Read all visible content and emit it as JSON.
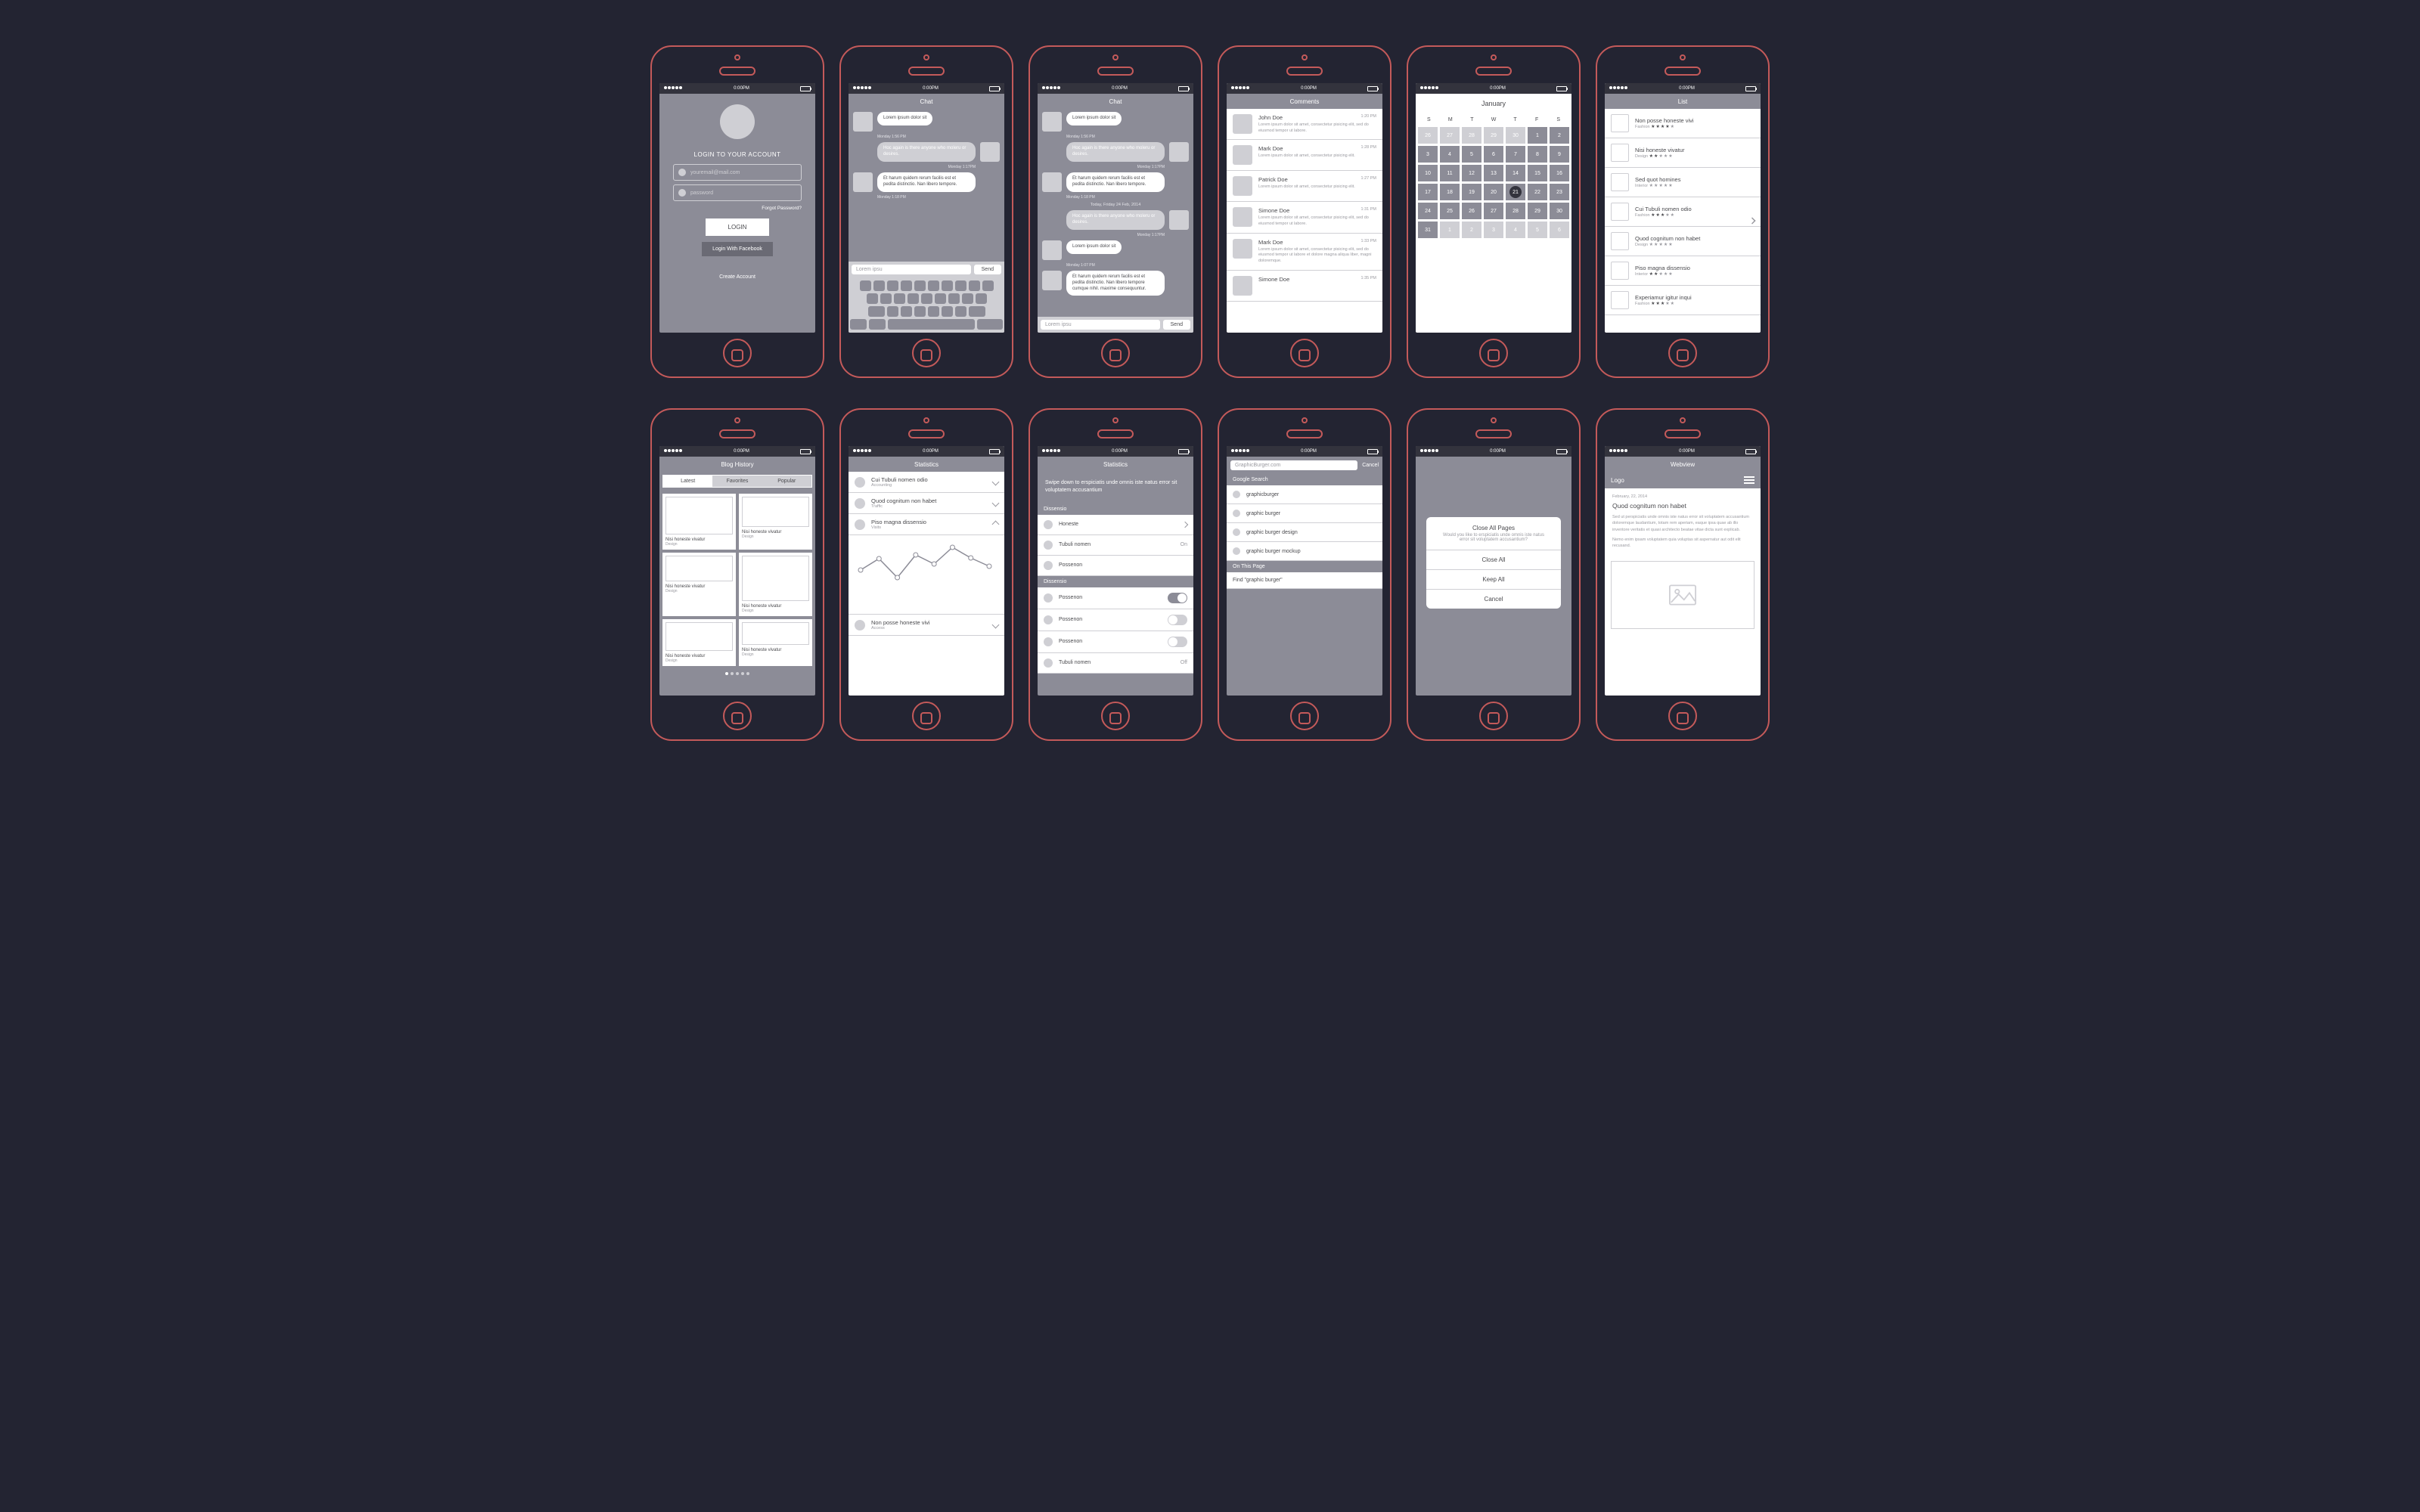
{
  "statusbar": {
    "time": "0:00PM"
  },
  "login": {
    "title": "LOGIN TO YOUR ACCOUNT",
    "email_ph": "youremail@mail.com",
    "pwd_ph": "password",
    "forgot": "Forgot Password?",
    "login_btn": "LOGIN",
    "fb_btn": "Login With Facebook",
    "create": "Create Account"
  },
  "chat": {
    "title": "Chat",
    "send": "Send",
    "input_ph": "Lorem ipsu",
    "date_divider": "Today, Friday 24 Feb, 2014",
    "msgs": [
      {
        "side": "l",
        "text": "Lorem ipsum dolor sit",
        "ts": "Monday 1:56 PM"
      },
      {
        "side": "r",
        "text": "Hoc again is there anyone who moleru or desires.",
        "ts": "Monday 1:17PM"
      },
      {
        "side": "l",
        "text": "Et harum quidem rerum facilis est et pedita distinctio. Nan libero tempore.",
        "ts": "Monday 1:18 PM"
      }
    ],
    "more": [
      {
        "side": "r",
        "text": "Hoc again is there anyone who moleru or desires.",
        "ts": "Monday 1:17PM"
      },
      {
        "side": "l",
        "text": "Lorem ipsum dolor sit",
        "ts": "Monday 1:07 PM"
      },
      {
        "side": "l",
        "text": "Et harum quidem rerum facilis est et pedita distinctio. Nan libero tempore cumque nihil. maxime consequuntur.",
        "ts": ""
      }
    ]
  },
  "comments": {
    "title": "Comments",
    "items": [
      {
        "name": "John Doe",
        "time": "1:20 PM",
        "text": "Lorem ipsum dolor sit amet, consectetur pisicing elit, sed do eiusmod tempor ut labore."
      },
      {
        "name": "Mark Doe",
        "time": "1:28 PM",
        "text": "Lorem ipsum dolor sit amet, consectetur pisicing elit."
      },
      {
        "name": "Patrick Doe",
        "time": "1:27 PM",
        "text": "Lorem ipsum dolor sit amet, consectetur pisicing elit."
      },
      {
        "name": "Simone Doe",
        "time": "1:31 PM",
        "text": "Lorem ipsum dolor sit amet, consectetur pisicing elit, sed do eiusmod tempor ut labore."
      },
      {
        "name": "Mark Doe",
        "time": "1:33 PM",
        "text": "Lorem ipsum dolor sit amet, consectetur pisicing elit, sed do eiusmod tempor ut labore et dolore magna aliqua liber, magni doloremque."
      },
      {
        "name": "Simone Doe",
        "time": "1:35 PM",
        "text": ""
      }
    ]
  },
  "calendar": {
    "month": "January",
    "dow": [
      "S",
      "M",
      "T",
      "W",
      "T",
      "F",
      "S"
    ],
    "leading": [
      26,
      27,
      28,
      29,
      30
    ],
    "days_in_month": 31,
    "today": 21,
    "trailing": [
      1,
      2,
      3,
      4,
      5,
      6
    ]
  },
  "list": {
    "title": "List",
    "items": [
      {
        "t": "Non posse honeste vivi",
        "s": "Fashion",
        "r": 4
      },
      {
        "t": "Nisi honeste vivatur",
        "s": "Design",
        "r": 2
      },
      {
        "t": "Sed quot homines",
        "s": "Interior",
        "r": 0
      },
      {
        "t": "Cui Tubuli nomen odio",
        "s": "Fashion",
        "r": 3
      },
      {
        "t": "Quod cognitum non habet",
        "s": "Design",
        "r": 0
      },
      {
        "t": "Piso magna dissensio",
        "s": "Interior",
        "r": 2
      },
      {
        "t": "Experiamur igitur inqui",
        "s": "Fashion",
        "r": 3
      }
    ]
  },
  "blog": {
    "title": "Blog History",
    "tabs": [
      "Latest",
      "Favorites",
      "Popular"
    ],
    "active_tab": 0,
    "card_title": "Nisi honeste vivatur",
    "card_sub": "Design"
  },
  "stats": {
    "title": "Statistics",
    "rows": [
      {
        "t": "Cui Tubuli nomen odio",
        "s": "Accounting",
        "open": false
      },
      {
        "t": "Quod cognitum non habet",
        "s": "Traffic",
        "open": false
      },
      {
        "t": "Piso magna dissensio",
        "s": "Visits",
        "open": true
      },
      {
        "t": "Non posse honeste vivi",
        "s": "Access",
        "open": false
      }
    ],
    "chart_data": {
      "type": "line",
      "x": [
        1,
        2,
        3,
        4,
        5,
        6,
        7,
        8
      ],
      "values": [
        40,
        55,
        30,
        60,
        48,
        70,
        56,
        45
      ]
    }
  },
  "settings": {
    "title": "Statistics",
    "blurb": "Swipe down to erspiciatis unde omnis iste natus error sit voluptatem accusantium",
    "sec1": "Dissensio",
    "rows1": [
      {
        "t": "Honeste",
        "type": "nav"
      },
      {
        "t": "Tubuli nomen",
        "type": "val",
        "v": "On"
      },
      {
        "t": "Possenon",
        "type": "none"
      }
    ],
    "sec2": "Dissensio",
    "rows2": [
      {
        "t": "Possenon",
        "type": "toggle",
        "on": true
      },
      {
        "t": "Possenon",
        "type": "toggle",
        "on": false
      },
      {
        "t": "Possenon",
        "type": "toggle",
        "on": false
      },
      {
        "t": "Tubuli nomen",
        "type": "val",
        "v": "Off"
      }
    ]
  },
  "search": {
    "query": "GraphicBurger.com",
    "cancel": "Cancel",
    "sec1": "Google Search",
    "sugs": [
      "graphicburger",
      "graphic burger",
      "graphic burger design",
      "graphic burger mockup"
    ],
    "sec2": "On This Page",
    "find": "Find \"graphic burger\""
  },
  "dialog": {
    "title": "Close All Pages",
    "body": "Would you like to erspiciatis unde omnis iste natus error sit voluptatem accusantium?",
    "opts": [
      "Close All",
      "Keep All",
      "Cancel"
    ]
  },
  "web": {
    "title": "Webview",
    "logo": "Logo",
    "date": "February, 22, 2014",
    "h": "Quod cognitum non habet",
    "p1": "Sed ut perspiciatis unde omnis iste natus error sit voluptatem accusantium doloremque laudantium, totam rem aperiam, eaque ipsa quae ab illo inventore veritatis et quasi architecto beatae vitae dicta sunt explicab.",
    "p2": "Nemo enim ipsam voluptatem quia voluptas sit aspernatur aut odit elit recusand."
  }
}
